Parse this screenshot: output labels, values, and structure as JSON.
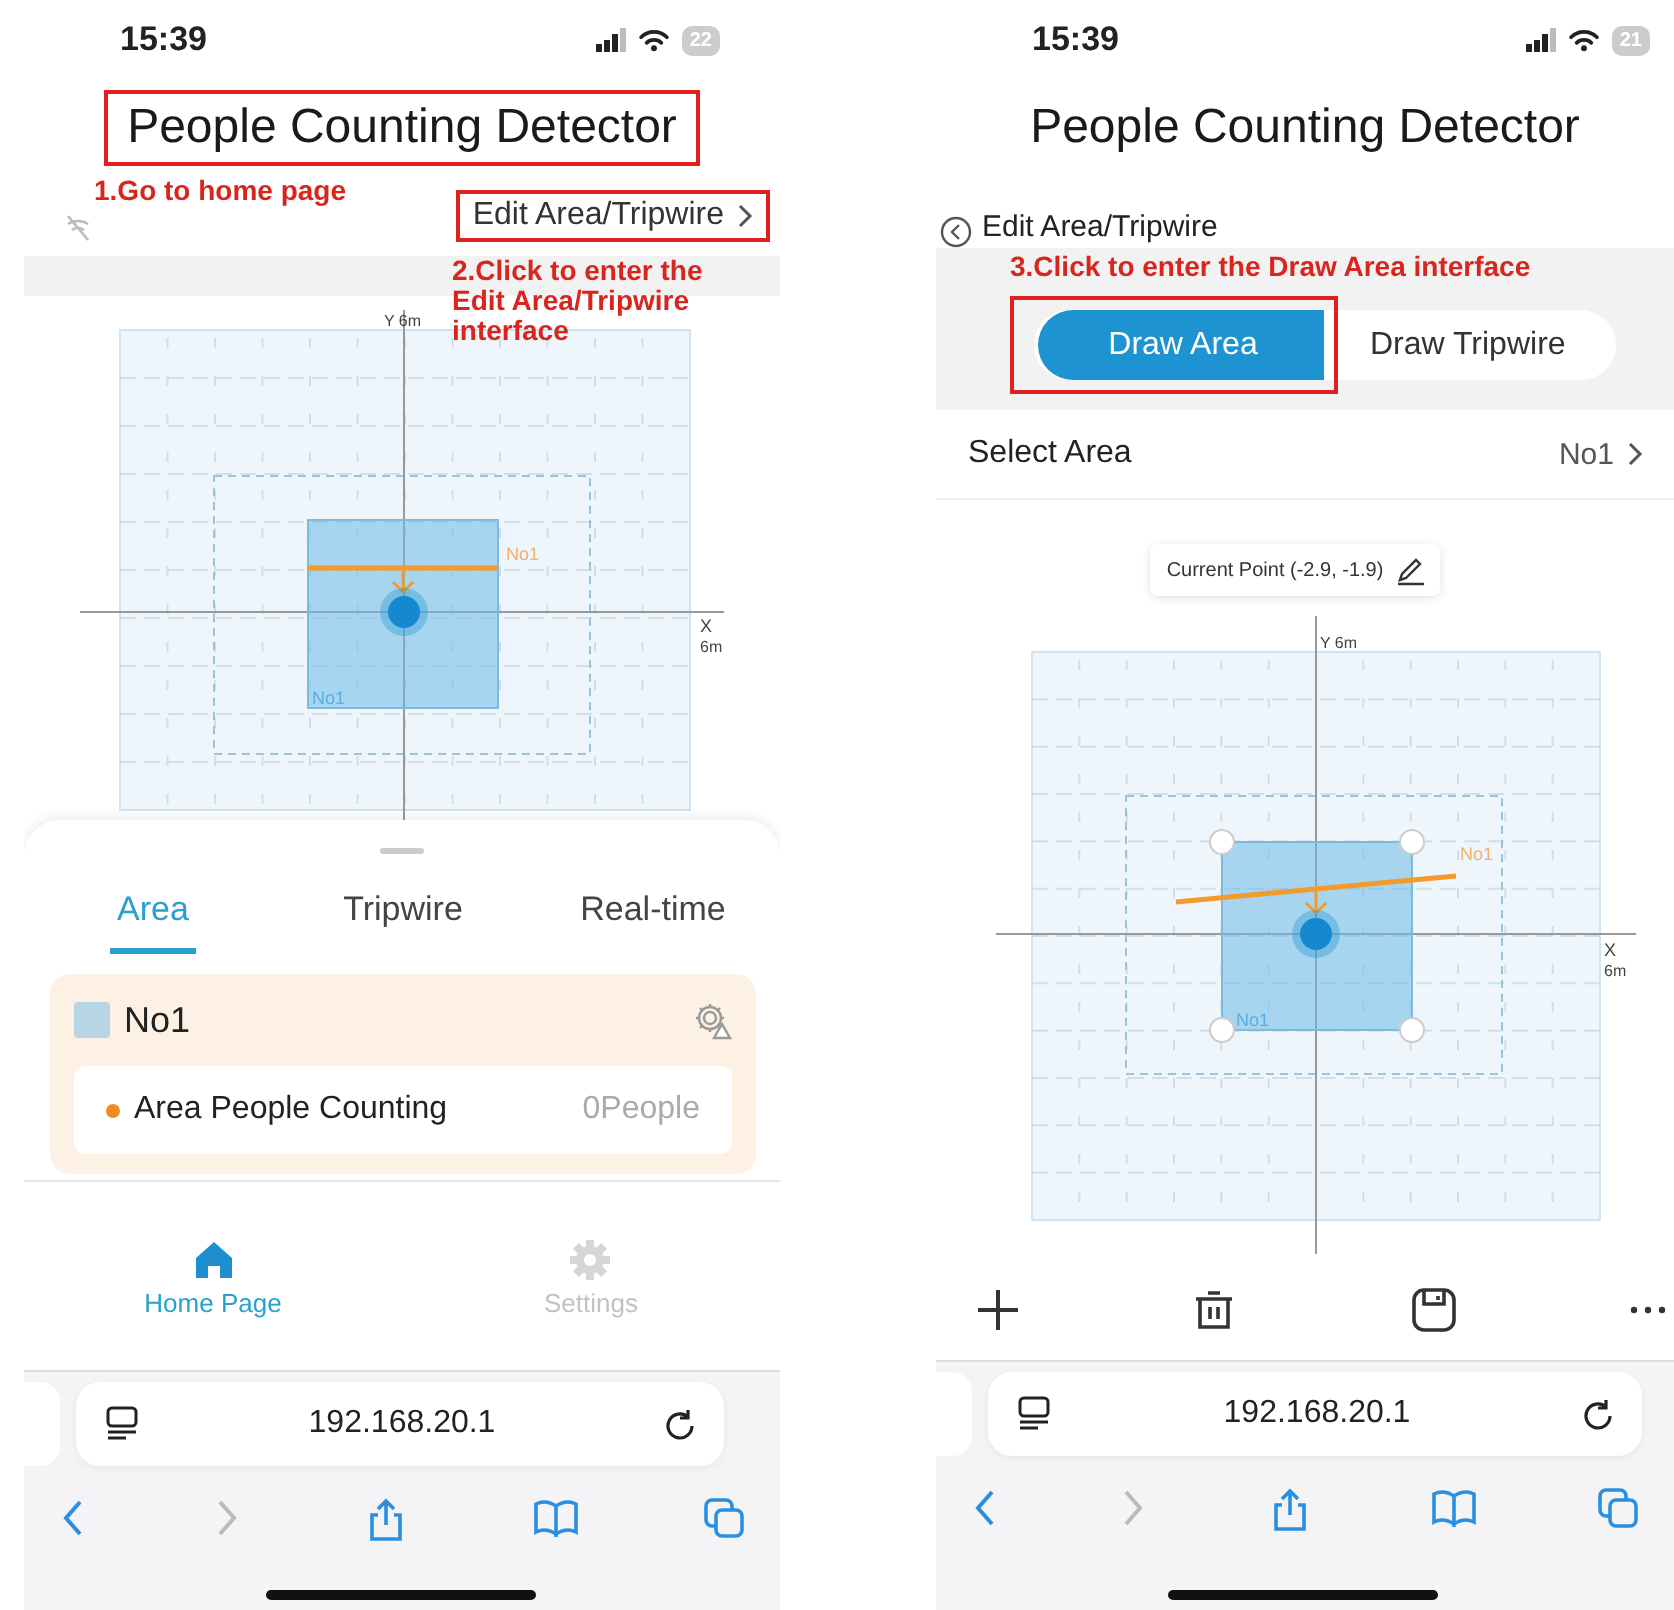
{
  "home_screen": {
    "status_bar": {
      "time": "15:39",
      "battery": "22"
    },
    "title": {
      "text": "People Counting Detector",
      "highlighted": true
    },
    "note_1": "1.Go to home page",
    "edit_link": {
      "label": "Edit Area/Tripwire",
      "highlighted": true
    },
    "note_2": "2.Click to enter the Edit Area/Tripwire interface",
    "map": {
      "editable": false,
      "y_label": "Y 6m",
      "x_label": "X",
      "x_unit": "6m",
      "tripwire_label": "No1",
      "area_label": "No1"
    },
    "tabs": [
      {
        "label": "Area",
        "selected": true
      },
      {
        "label": "Tripwire",
        "selected": false
      },
      {
        "label": "Real-time",
        "selected": false
      }
    ],
    "area_card": {
      "name": "No1",
      "rows": [
        {
          "label": "Area People Counting",
          "value": "0People"
        }
      ]
    },
    "nav": [
      {
        "label": "Home Page",
        "selected": true
      },
      {
        "label": "Settings",
        "selected": false
      }
    ],
    "browser": {
      "url": "192.168.20.1",
      "forward_disabled": true
    }
  },
  "edit_screen": {
    "status_bar": {
      "time": "15:39",
      "battery": "21"
    },
    "title": {
      "text": "People Counting Detector",
      "highlighted": false
    },
    "back_label": "Edit Area/Tripwire",
    "note_3": "3.Click to enter the Draw Area interface",
    "modes": [
      {
        "label": "Draw Area",
        "selected": true,
        "highlighted": true
      },
      {
        "label": "Draw Tripwire",
        "selected": false,
        "highlighted": false
      }
    ],
    "select_area": {
      "label": "Select Area",
      "value": "No1"
    },
    "current_point": "Current Point (-2.9, -1.9)",
    "map": {
      "editable": true,
      "y_label": "Y 6m",
      "x_label": "X",
      "x_unit": "6m",
      "tripwire_label": "No1",
      "area_label": "No1"
    },
    "browser": {
      "url": "192.168.20.1",
      "forward_disabled": true
    }
  }
}
